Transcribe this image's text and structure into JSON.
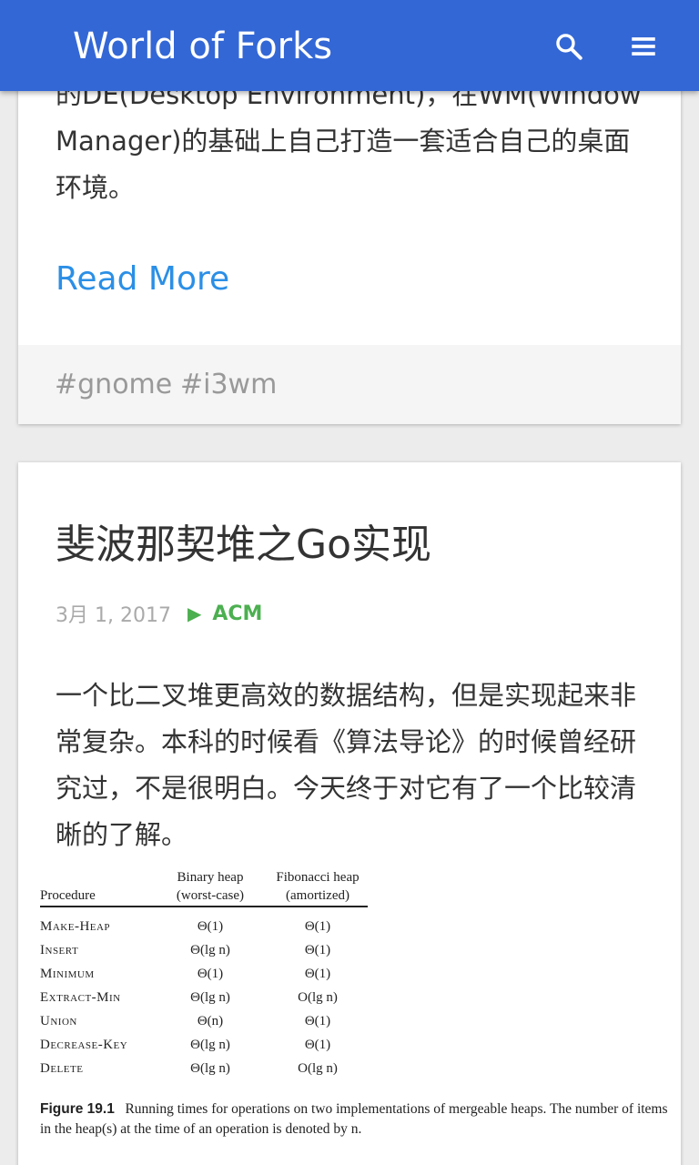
{
  "app": {
    "title": "World of Forks"
  },
  "header": {
    "search_icon": "search-icon",
    "menu_icon": "hamburger-menu-icon"
  },
  "previous_post": {
    "excerpt": "的DE(Desktop Environment)，在WM(Window Manager)的基础上自己打造一套适合自己的桌面环境。",
    "read_more_label": "Read More",
    "tags": [
      "#gnome",
      "#i3wm"
    ]
  },
  "post": {
    "title": "斐波那契堆之Go实现",
    "date": "3月 1, 2017",
    "category": "ACM",
    "excerpt": "一个比二叉堆更高效的数据结构，但是实现起来非常复杂。本科的时候看《算法导论》的时候曾经研究过，不是很明白。今天终于对它有了一个比较清晰的了解。",
    "figure": {
      "header_procedure": "Procedure",
      "header_binary_line1": "Binary heap",
      "header_binary_line2": "(worst-case)",
      "header_fib_line1": "Fibonacci heap",
      "header_fib_line2": "(amortized)",
      "rows": [
        {
          "procedure": "Make-Heap",
          "binary": "Θ(1)",
          "fib": "Θ(1)"
        },
        {
          "procedure": "Insert",
          "binary": "Θ(lg n)",
          "fib": "Θ(1)"
        },
        {
          "procedure": "Minimum",
          "binary": "Θ(1)",
          "fib": "Θ(1)"
        },
        {
          "procedure": "Extract-Min",
          "binary": "Θ(lg n)",
          "fib": "O(lg n)"
        },
        {
          "procedure": "Union",
          "binary": "Θ(n)",
          "fib": "Θ(1)"
        },
        {
          "procedure": "Decrease-Key",
          "binary": "Θ(lg n)",
          "fib": "Θ(1)"
        },
        {
          "procedure": "Delete",
          "binary": "Θ(lg n)",
          "fib": "O(lg n)"
        }
      ],
      "caption_label": "Figure 19.1",
      "caption_text": "Running times for operations on two implementations of mergeable heaps. The number of items in the heap(s) at the time of an operation is denoted by n."
    }
  },
  "colors": {
    "appbar": "#3367d6",
    "link": "#2b8fe6",
    "category": "#4caf50",
    "tag": "#999999"
  }
}
